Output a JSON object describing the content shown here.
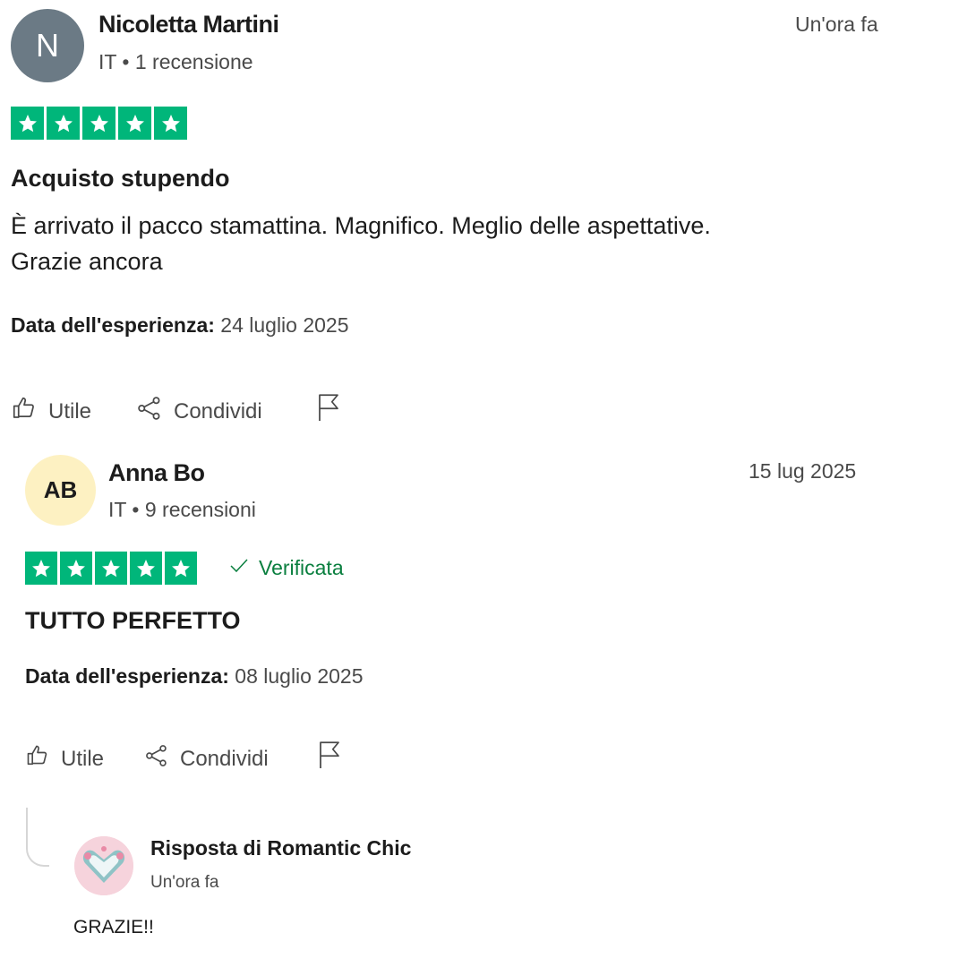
{
  "reviews": [
    {
      "avatar_initials": "N",
      "avatar_color": "#6b7a85",
      "name": "Nicoletta Martini",
      "meta": "IT • 1 recensione",
      "time": "Un'ora fa",
      "rating": 5,
      "title": "Acquisto stupendo",
      "body_line1": "È arrivato il pacco stamattina. Magnifico. Meglio delle aspettative.",
      "body_line2": "Grazie ancora",
      "exp_label": "Data dell'esperienza:",
      "exp_date": "24 luglio 2025"
    },
    {
      "avatar_initials": "AB",
      "avatar_color": "#fdf1c2",
      "name": "Anna Bo",
      "meta": "IT • 9 recensioni",
      "time": "15 lug 2025",
      "rating": 5,
      "verified": "Verificata",
      "title": "TUTTO PERFETTO",
      "exp_label": "Data dell'esperienza:",
      "exp_date": "08 luglio 2025"
    }
  ],
  "actions": {
    "useful": "Utile",
    "share": "Condividi"
  },
  "reply": {
    "title": "Risposta di Romantic Chic",
    "time": "Un'ora fa",
    "text": "GRAZIE!!"
  },
  "colors": {
    "star_green": "#00b67a",
    "verified_green": "#0a7f3f"
  },
  "icons": [
    "thumbs-up-icon",
    "share-icon",
    "flag-icon",
    "star-icon",
    "checkmark-icon"
  ]
}
